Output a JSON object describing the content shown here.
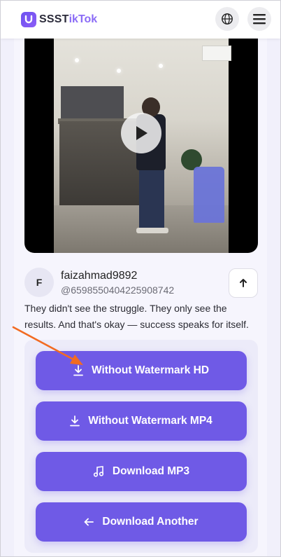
{
  "header": {
    "logo_text": "SSST",
    "logo_accent": "ikTok",
    "globe_icon": "globe-icon",
    "menu_icon": "hamburger-menu-icon"
  },
  "video": {
    "play_icon": "play-icon"
  },
  "author": {
    "avatar_letter": "F",
    "username": "faizahmad9892",
    "user_id": "@6598550404225908742",
    "share_icon": "arrow-up-icon"
  },
  "caption": "They didn't see the struggle. They only see the results. And that's okay — success speaks for itself.",
  "downloads": [
    {
      "label": "Without Watermark HD",
      "icon": "download-icon"
    },
    {
      "label": "Without Watermark MP4",
      "icon": "download-icon"
    },
    {
      "label": "Download MP3",
      "icon": "music-note-icon"
    },
    {
      "label": "Download Another",
      "icon": "arrow-left-icon"
    }
  ],
  "annotation": {
    "color": "#f26b22"
  },
  "colors": {
    "accent": "#6f5ae6",
    "background": "#f1f0fb"
  }
}
